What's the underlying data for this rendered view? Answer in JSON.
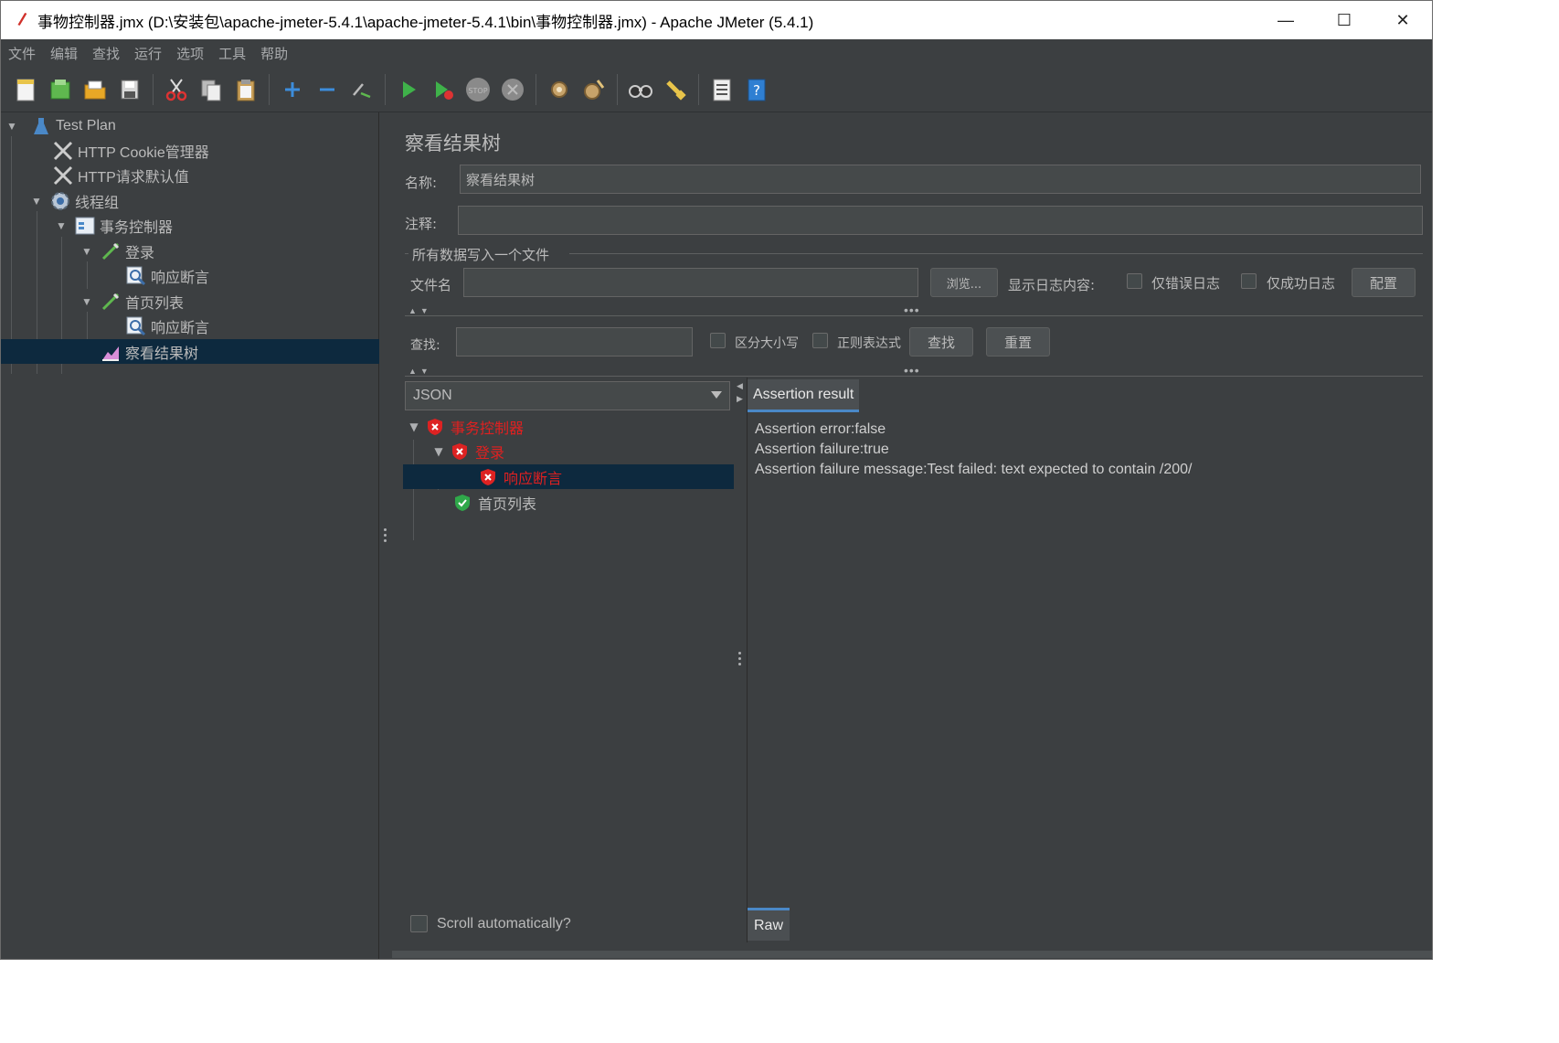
{
  "window": {
    "title": "事物控制器.jmx (D:\\安装包\\apache-jmeter-5.4.1\\apache-jmeter-5.4.1\\bin\\事物控制器.jmx) - Apache JMeter (5.4.1)",
    "minimize": "—",
    "maximize": "☐",
    "close": "✕"
  },
  "menu": [
    "文件",
    "编辑",
    "查找",
    "运行",
    "选项",
    "工具",
    "帮助"
  ],
  "toolbar_icons": [
    "new-icon",
    "templates-icon",
    "open-icon",
    "save-icon",
    "cut-icon",
    "copy-icon",
    "paste-icon",
    "expand-icon",
    "collapse-icon",
    "toggle-icon",
    "start-icon",
    "start-no-pause-icon",
    "stop-icon",
    "shutdown-icon",
    "clear-icon",
    "clear-all-icon",
    "search-icon",
    "reset-search-icon",
    "function-helper-icon",
    "help-icon"
  ],
  "tree": {
    "items": [
      {
        "label": "Test Plan",
        "icon": "flask-icon"
      },
      {
        "label": "HTTP Cookie管理器",
        "icon": "wrench-icon"
      },
      {
        "label": "HTTP请求默认值",
        "icon": "wrench-icon"
      },
      {
        "label": "线程组",
        "icon": "gear-icon"
      },
      {
        "label": "事务控制器",
        "icon": "controller-icon"
      },
      {
        "label": "登录",
        "icon": "pipette-icon"
      },
      {
        "label": "响应断言",
        "icon": "magnifier-icon"
      },
      {
        "label": "首页列表",
        "icon": "pipette-icon"
      },
      {
        "label": "响应断言",
        "icon": "magnifier-icon"
      },
      {
        "label": "察看结果树",
        "icon": "chart-icon"
      }
    ],
    "selected_index": 9
  },
  "panel": {
    "title": "察看结果树",
    "name_label": "名称:",
    "name_value": "察看结果树",
    "comment_label": "注释:",
    "comment_value": "",
    "file_group_label": "所有数据写入一个文件",
    "filename_label": "文件名",
    "filename_value": "",
    "browse_button": "浏览...",
    "log_label": "显示日志内容:",
    "errors_only": "仅错误日志",
    "success_only": "仅成功日志",
    "configure_button": "配置",
    "search_label": "查找:",
    "search_value": "",
    "case_sensitive": "区分大小写",
    "regex": "正则表达式",
    "find_button": "查找",
    "reset_button": "重置"
  },
  "results": {
    "renderer": "JSON",
    "items": [
      {
        "label": "事务控制器",
        "status": "fail"
      },
      {
        "label": "登录",
        "status": "fail"
      },
      {
        "label": "响应断言",
        "status": "fail"
      },
      {
        "label": "首页列表",
        "status": "ok"
      }
    ],
    "scroll_auto": "Scroll automatically?",
    "tab_assertion": "Assertion result",
    "tab_raw": "Raw",
    "assertion_lines": [
      "Assertion error:false",
      "Assertion failure:true",
      "Assertion failure message:Test failed: text expected to contain /200/"
    ]
  },
  "colors": {
    "background": "#3c3f41",
    "selection": "#0d293e",
    "fail_text": "#e02020",
    "accent": "#4a88c7"
  }
}
